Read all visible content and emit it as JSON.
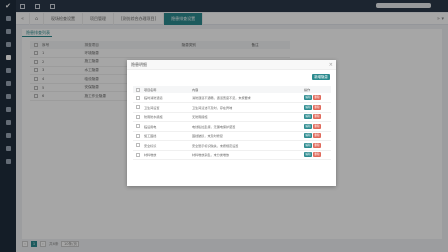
{
  "tabs": {
    "items": [
      {
        "label": "现场检查设置"
      },
      {
        "label": "项目管理"
      },
      {
        "label": "[测仿综合办理项目]"
      },
      {
        "label": "隐患排查设置"
      }
    ]
  },
  "panel": {
    "title": "隐患排查列表",
    "headers": [
      "序号",
      "排查项目",
      "隐患类别",
      "备注"
    ],
    "rows": [
      {
        "no": "1",
        "name": "环境隐患"
      },
      {
        "no": "2",
        "name": "施工隐患"
      },
      {
        "no": "3",
        "name": "水工隐患"
      },
      {
        "no": "4",
        "name": "临设隐患"
      },
      {
        "no": "5",
        "name": "安保隐患"
      },
      {
        "no": "6",
        "name": "施工作业隐患"
      }
    ]
  },
  "pager": {
    "pages": [
      "1"
    ],
    "total": "共6条",
    "per_page": "10条/页"
  },
  "modal": {
    "title": "隐患明细",
    "close": "×",
    "add_label": "新增隐患",
    "headers": [
      "项目名称",
      "内容",
      "操作"
    ],
    "rows": [
      {
        "name": "临时消防通道",
        "content": "消防通道不通畅，通道宽度不足，未按要求"
      },
      {
        "name": "卫生间设置",
        "content": "卫生间清洁不及时，存在异味"
      },
      {
        "name": "防雨防水措施",
        "content": "无防雨措施"
      },
      {
        "name": "临设用电",
        "content": "电线私拉乱接，无漏电保护装置"
      },
      {
        "name": "施工围挡",
        "content": "围挡破损，未及时修复"
      },
      {
        "name": "安全标识",
        "content": "安全警示标识缺失，未按规定设置"
      },
      {
        "name": "材料堆放",
        "content": "材料堆放杂乱，未分类堆放"
      }
    ],
    "btn_edit": "编辑",
    "btn_del": "删除"
  }
}
